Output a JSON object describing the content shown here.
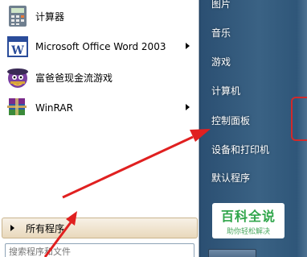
{
  "start_menu": {
    "programs": [
      {
        "label": "计算器",
        "icon": "calculator-icon",
        "has_submenu": false
      },
      {
        "label": "Microsoft Office Word 2003",
        "icon": "word-icon",
        "has_submenu": true
      },
      {
        "label": "富爸爸现金流游戏",
        "icon": "game-icon",
        "has_submenu": false
      },
      {
        "label": "WinRAR",
        "icon": "winrar-icon",
        "has_submenu": true
      }
    ],
    "all_programs_label": "所有程序",
    "search_placeholder": "搜索程序和文件"
  },
  "right_panel": {
    "items": [
      {
        "label": "图片"
      },
      {
        "label": "音乐"
      },
      {
        "label": "游戏"
      },
      {
        "label": "计算机"
      },
      {
        "label": "控制面板"
      },
      {
        "label": "设备和打印机"
      },
      {
        "label": "默认程序"
      }
    ]
  },
  "watermark": {
    "title": "百科全说",
    "subtitle": "助你轻松解决"
  },
  "colors": {
    "arrow": "#e02020",
    "right_panel": "#2f5679",
    "watermark_green": "#2fa54a"
  }
}
